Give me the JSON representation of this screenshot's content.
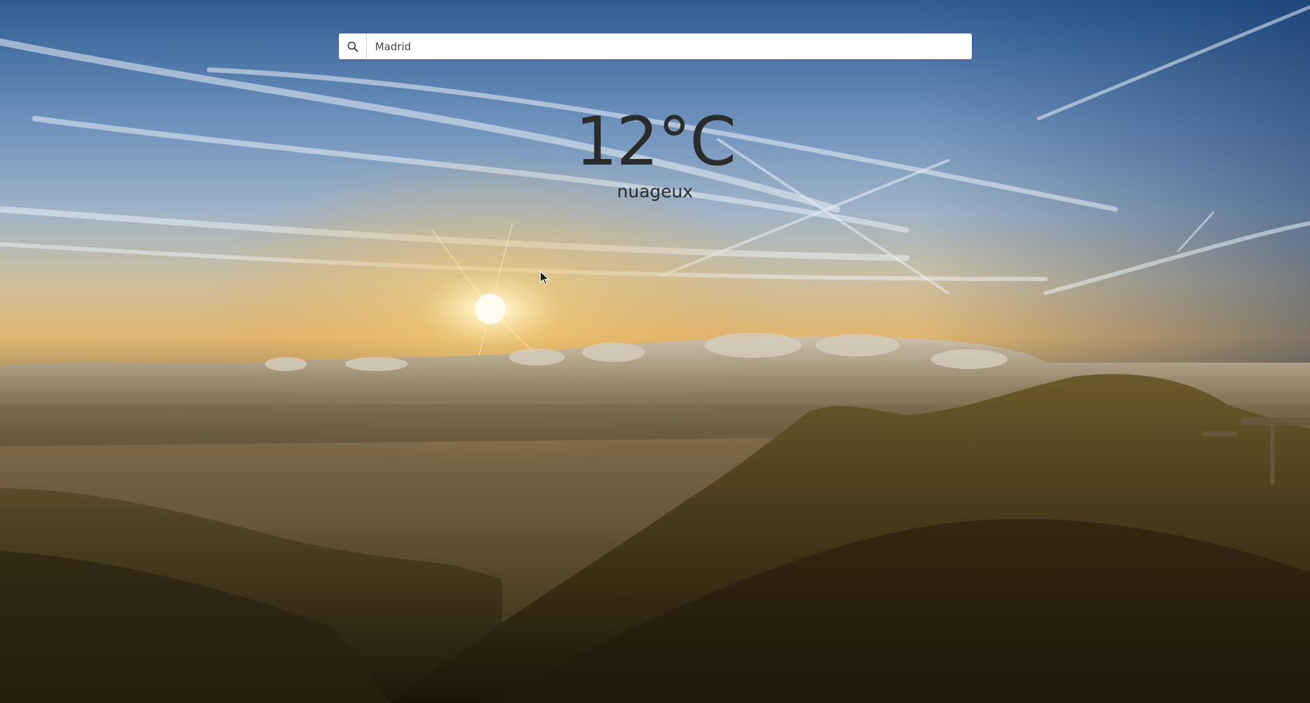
{
  "search": {
    "value": "Madrid",
    "icon": "search-icon"
  },
  "weather": {
    "temperature": "12°C",
    "description": "nuageux"
  },
  "colors": {
    "sky_top": "#3e6ea3",
    "sky_horizon": "#d8b470",
    "clouds": "#8c7a5c",
    "mountain": "#3d3216",
    "text": "#2b2b2b"
  }
}
